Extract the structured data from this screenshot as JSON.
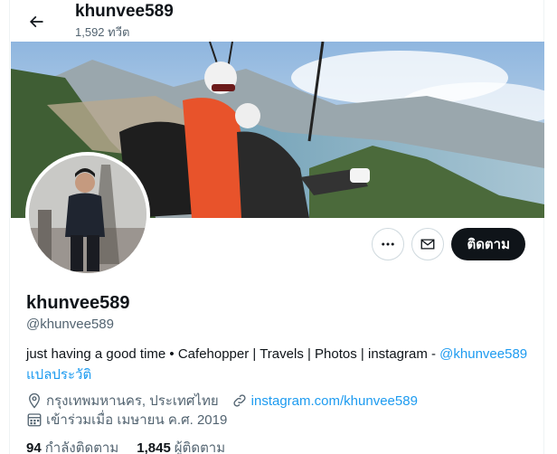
{
  "header": {
    "name": "khunvee589",
    "tweet_count": "1,592 ทวีต"
  },
  "profile": {
    "display_name": "khunvee589",
    "handle": "@khunvee589",
    "bio_text": "just having a good time • Cafehopper | Travels | Photos | instagram - ",
    "bio_link": "@khunvee589",
    "translate_label": "แปลประวัติ",
    "location": "กรุงเทพมหานคร, ประเทศไทย",
    "website": "instagram.com/khunvee589",
    "joined": "เข้าร่วมเมื่อ เมษายน ค.ศ. 2019"
  },
  "actions": {
    "more_icon": "more-dots-icon",
    "message_icon": "envelope-icon",
    "follow_label": "ติดตาม"
  },
  "stats": {
    "following_count": "94",
    "following_label": "กำลังติดตาม",
    "followers_count": "1,845",
    "followers_label": "ผู้ติดตาม"
  },
  "colors": {
    "accent": "#1d9bf0",
    "text": "#0f1419",
    "secondary": "#536471"
  }
}
